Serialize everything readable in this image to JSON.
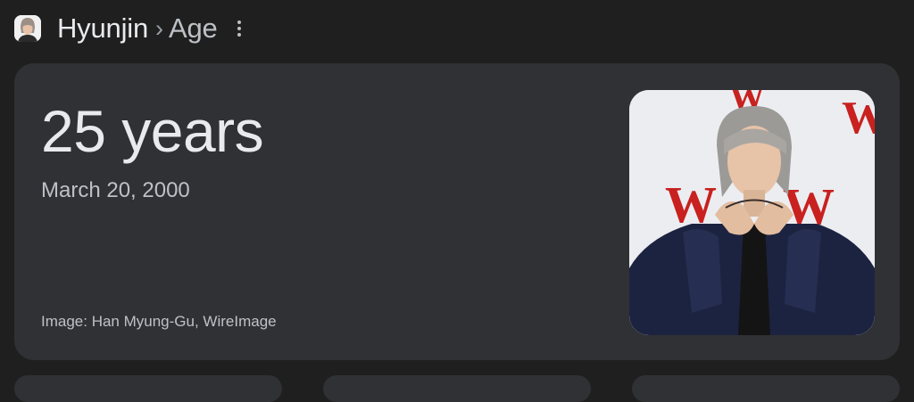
{
  "breadcrumb": {
    "name": "Hyunjin",
    "separator": "›",
    "current": "Age"
  },
  "answer": {
    "age": "25 years",
    "birth_date": "March 20, 2000",
    "image_credit": "Image: Han Myung-Gu, WireImage"
  },
  "icons": {
    "more": "more-vert-icon"
  },
  "colors": {
    "page_background": "#1f1f1f",
    "card_background": "#303134",
    "primary_text": "#e8eaed",
    "secondary_text": "#bdc1c6",
    "backdrop_red": "#c8211f",
    "jacket": "#1c2340"
  }
}
